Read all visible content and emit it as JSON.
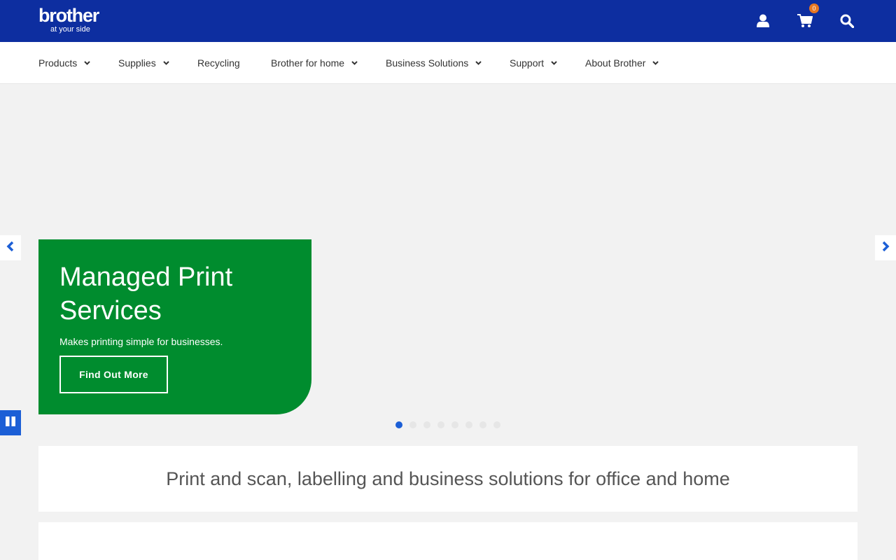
{
  "header": {
    "logo_word": "brother",
    "logo_tagline": "at your side",
    "cart_count": "0",
    "icons": [
      "user-icon",
      "cart-icon",
      "search-icon"
    ],
    "bg_color": "#0d2ea0"
  },
  "nav": {
    "items": [
      {
        "label": "Products",
        "dropdown": true
      },
      {
        "label": "Supplies",
        "dropdown": true
      },
      {
        "label": "Recycling",
        "dropdown": false
      },
      {
        "label": "Brother for home",
        "dropdown": true
      },
      {
        "label": "Business Solutions",
        "dropdown": true
      },
      {
        "label": "Support",
        "dropdown": true
      },
      {
        "label": "About Brother",
        "dropdown": true
      }
    ]
  },
  "hero": {
    "title": "Managed Print Services",
    "text": "Makes printing simple for businesses.",
    "button_label": "Find Out More",
    "card_color": "#008c2e",
    "slide_count": 8,
    "active_slide": 1
  },
  "intro": {
    "text": "Print and scan, labelling and business solutions for office and home"
  },
  "colors": {
    "accent": "#1c5fd6",
    "badge": "#e87722"
  }
}
